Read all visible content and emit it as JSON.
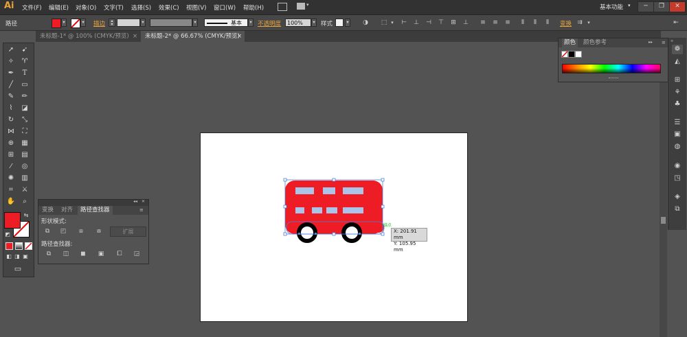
{
  "app": {
    "logo": "Ai",
    "workspace": "基本功能",
    "workspace_arrow": "▾"
  },
  "menu": [
    "文件(F)",
    "编辑(E)",
    "对象(O)",
    "文字(T)",
    "选择(S)",
    "效果(C)",
    "视图(V)",
    "窗口(W)",
    "帮助(H)"
  ],
  "window_buttons": [
    "─",
    "❐",
    "✕"
  ],
  "control": {
    "selection_label": "路径",
    "stroke_label": "描边",
    "stroke_profile": "基本",
    "opacity_label": "不透明度",
    "opacity_value": "100%",
    "style_label": "样式",
    "transform_label": "变换"
  },
  "tabs": [
    {
      "label": "未标题-1* @ 100% (CMYK/预览)",
      "active": false,
      "close": "×"
    },
    {
      "label": "未标题-2* @ 66.67% (CMYK/预览)",
      "active": true,
      "close": "×"
    }
  ],
  "pathfinder": {
    "tabs": [
      "变换",
      "对齐",
      "路径查找器"
    ],
    "shape_modes_label": "形状模式:",
    "expand_label": "扩展",
    "pathfinders_label": "路径查找器:",
    "collapse": "◂◂",
    "close": "✕"
  },
  "color_panel": {
    "tabs": [
      "颜色",
      "颜色参考"
    ],
    "menu": "▸▸"
  },
  "canvas": {
    "tooltip_x": "X: 201.91 mm",
    "tooltip_y": "Y: 105.95 mm",
    "anchor_hint": "锚点"
  },
  "colors": {
    "fill": "#ee1c24",
    "window": "#a9c4e8",
    "selection": "#4f7fd6",
    "accent": "#e8a23a"
  },
  "icons": {
    "selection_tool": "arrow",
    "direct_selection": "white-arrow",
    "pen": "pen",
    "type": "T",
    "fill_swatch": "red",
    "stroke_swatch": "none"
  }
}
